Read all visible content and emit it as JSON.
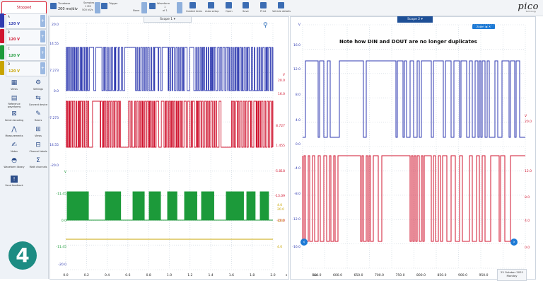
{
  "toolbar": {
    "status": "Stopped",
    "timebase_label": "Timebase",
    "timebase_value": "200 ms/div",
    "samples_label": "Samples",
    "samples_value": "1 MS",
    "sample_rate": "500 kS/s",
    "trigger_label": "Trigger",
    "trigger_mode": "None",
    "waveform_label": "Waveform",
    "waveform_value": "1",
    "waveform_of": "of 1",
    "guided_tests": "Guided tests",
    "auto_setup": "Auto setup",
    "open": "Open",
    "save": "Save",
    "print": "Print",
    "vehicle_details": "Vehicle details",
    "logo": "pico",
    "logo_sub": "Technology"
  },
  "channels": [
    {
      "letter": "A",
      "range": "120 V",
      "color": "#2f3ab0"
    },
    {
      "letter": "B",
      "range": "120 V",
      "color": "#d0142f"
    },
    {
      "letter": "C",
      "range": "120 V",
      "color": "#1c9a3a"
    },
    {
      "letter": "D",
      "range": "120 V",
      "color": "#c8a400"
    }
  ],
  "sidebar": {
    "items": [
      {
        "icon": "grid-icon",
        "label": "Views"
      },
      {
        "icon": "gear-icon",
        "label": "Settings"
      },
      {
        "icon": "reference-waveforms-icon",
        "label": "Reference waveforms"
      },
      {
        "icon": "connect-device-icon",
        "label": "Connect device"
      },
      {
        "icon": "serial-decoding-icon",
        "label": "Serial decoding"
      },
      {
        "icon": "rulers-icon",
        "label": "Rulers"
      },
      {
        "icon": "measurements-icon",
        "label": "Measurements"
      },
      {
        "icon": "views-grid-icon",
        "label": "Views"
      },
      {
        "icon": "notes-icon",
        "label": "Notes"
      },
      {
        "icon": "channel-labels-icon",
        "label": "Channel labels"
      },
      {
        "icon": "waveform-library-icon",
        "label": "Waveform library"
      },
      {
        "icon": "math-channels-icon",
        "label": "Math channels"
      },
      {
        "icon": "send-feedback-icon",
        "label": "Send feedback"
      }
    ],
    "step_badge": "4"
  },
  "scope1": {
    "title": "Scope 1",
    "a_ticks": [
      "20.0",
      "14.55",
      "7.273",
      "0.0",
      "-7.273",
      "14.55",
      "-20.0"
    ],
    "b_ticks": [
      "V",
      "20.0",
      "16.0",
      "8.727",
      "1.455",
      "-5.818",
      "-13.09",
      "-20.0"
    ],
    "c_ticks": [
      "V",
      "-11.45",
      "0.0",
      "-11.45",
      "-20.0"
    ],
    "d_ticks": [
      "4.0",
      "20.0",
      "12.0",
      "4.0"
    ],
    "x_ticks": [
      "0.0",
      "0.2",
      "0.4",
      "0.6",
      "0.8",
      "1.0",
      "1.2",
      "1.4",
      "1.6",
      "1.8",
      "2.0"
    ],
    "x_unit": "s"
  },
  "scope2": {
    "title": "Scope 2",
    "zoom_label": "Zoom",
    "note": "Note how DIN and DOUT are no longer duplicates",
    "a_ticks": [
      "V",
      "16.0",
      "12.0",
      "8.0",
      "4.0",
      "0.0",
      "-4.0",
      "-8.0",
      "-12.0",
      "-16.0"
    ],
    "b_ticks": [
      "V",
      "20.0",
      "12.0",
      "8.0",
      "4.0",
      "0.0"
    ],
    "x_ticks": [
      "550.0",
      "600.0",
      "650.0",
      "700.0",
      "750.0",
      "800.0",
      "850.0",
      "900.0",
      "950.0",
      "1000.0"
    ],
    "x_first_unit": "ms",
    "date": "25 October 2021",
    "day": "Monday"
  },
  "colors": {
    "accent": "#1e7bd6",
    "badge": "#1d8c83",
    "chA": "#2f3ab0",
    "chB": "#d0142f",
    "chC": "#1c9a3a",
    "chD": "#c8a400"
  }
}
